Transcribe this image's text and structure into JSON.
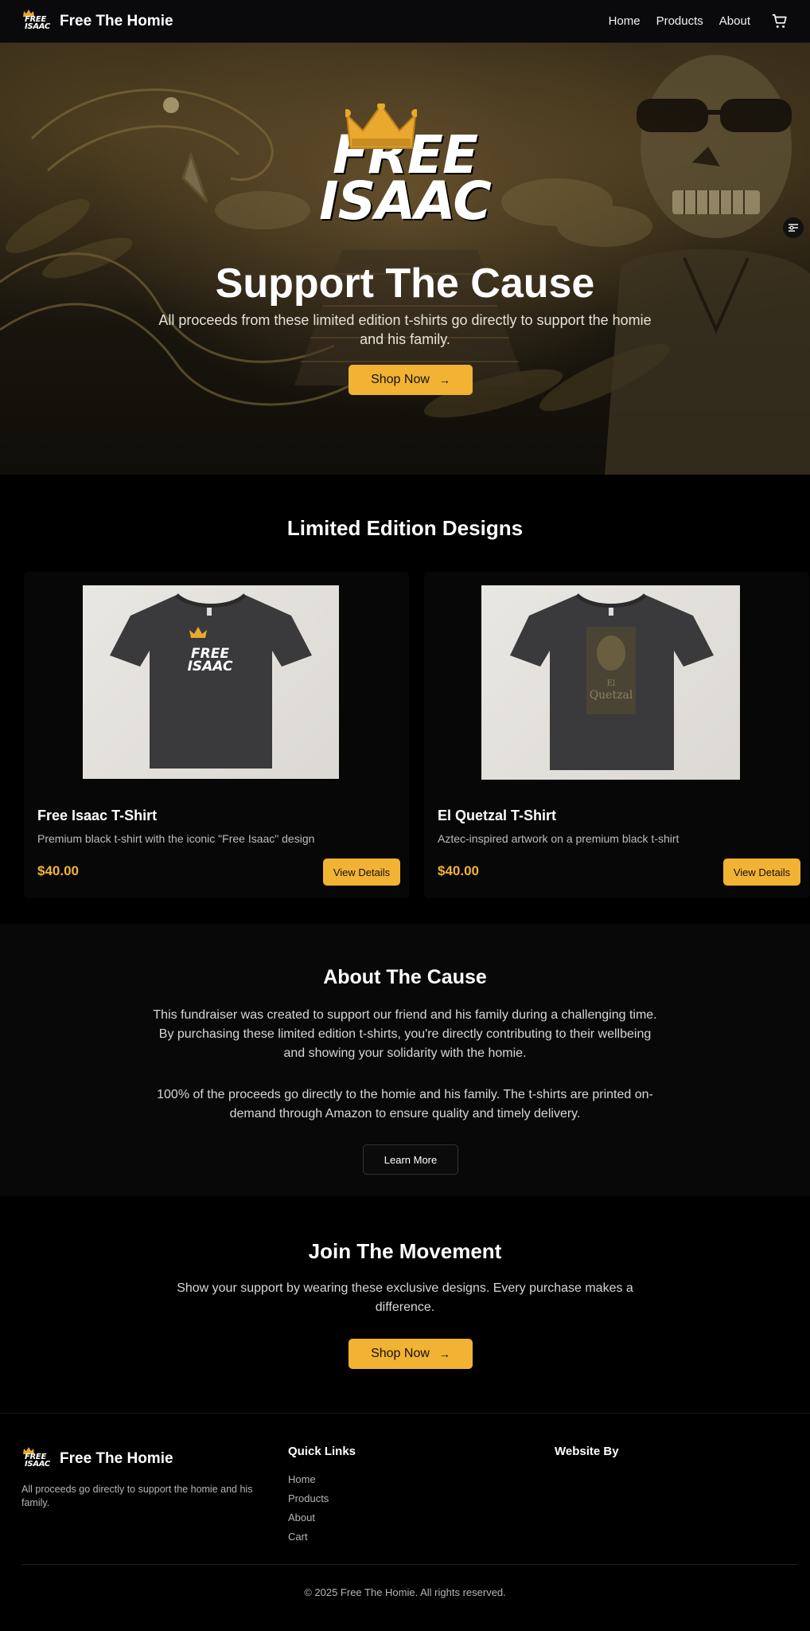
{
  "nav": {
    "brand": "Free The Homie",
    "logo_text_line1": "FREE",
    "logo_text_line2": "ISAAC",
    "links": [
      "Home",
      "Products",
      "About"
    ],
    "cart_icon": "cart-icon"
  },
  "hero": {
    "logo_line1": "FREE",
    "logo_line2": "ISAAC",
    "title": "Support The Cause",
    "subtitle": "All proceeds from these limited edition t-shirts go directly to support the homie and his family.",
    "cta_label": "Shop Now",
    "cta_icon": "arrow-right-icon"
  },
  "products": {
    "title": "Limited Edition Designs",
    "items": [
      {
        "name": "Free Isaac T-Shirt",
        "description": "Premium black t-shirt with the iconic \"Free Isaac\" design",
        "price": "$40.00",
        "button_label": "View Details",
        "shirt_print_line1": "FREE",
        "shirt_print_line2": "ISAAC"
      },
      {
        "name": "El Quetzal T-Shirt",
        "description": "Aztec-inspired artwork on a premium black t-shirt",
        "price": "$40.00",
        "button_label": "View Details",
        "shirt_print_line1": "El",
        "shirt_print_line2": "Quetzal"
      }
    ]
  },
  "about": {
    "title": "About The Cause",
    "paragraph1": "This fundraiser was created to support our friend and his family during a challenging time. By purchasing these limited edition t-shirts, you're directly contributing to their wellbeing and showing your solidarity with the homie.",
    "paragraph2": "100% of the proceeds go directly to the homie and his family. The t-shirts are printed on-demand through Amazon to ensure quality and timely delivery.",
    "button_label": "Learn More"
  },
  "join": {
    "title": "Join The Movement",
    "text": "Show your support by wearing these exclusive designs. Every purchase makes a difference.",
    "cta_label": "Shop Now"
  },
  "footer": {
    "brand": "Free The Homie",
    "tagline": "All proceeds go directly to support the homie and his family.",
    "quick_links_title": "Quick Links",
    "quick_links": [
      "Home",
      "Products",
      "About",
      "Cart"
    ],
    "website_by_title": "Website By",
    "copyright": "© 2025 Free The Homie. All rights reserved."
  },
  "colors": {
    "accent": "#f2b233",
    "background": "#000000",
    "card": "#070707"
  }
}
